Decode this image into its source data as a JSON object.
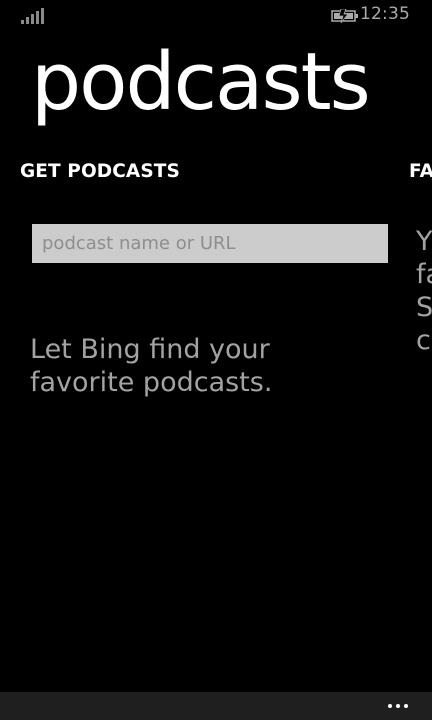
{
  "status_bar": {
    "time": "12:35",
    "signal_icon": "signal-strength-icon",
    "battery_icon": "battery-charging-icon"
  },
  "app": {
    "title": "podcasts"
  },
  "pivots": [
    {
      "label": "GET PODCASTS",
      "state": "current"
    },
    {
      "label": "FAV",
      "state": "next-partially-visible"
    }
  ],
  "get_podcasts": {
    "search_placeholder": "podcast name or URL",
    "search_value": "",
    "hint": "Let Bing find your favorite podcasts."
  },
  "favorites_peek": {
    "visible_text": "Y\nfa\nS\nc"
  },
  "app_bar": {
    "more_icon": "ellipsis-icon"
  },
  "colors": {
    "background": "#000000",
    "foreground": "#ffffff",
    "subtle_text": "#a3a3a3",
    "input_background": "#cccccc",
    "app_bar_background": "#1f1f1f"
  }
}
